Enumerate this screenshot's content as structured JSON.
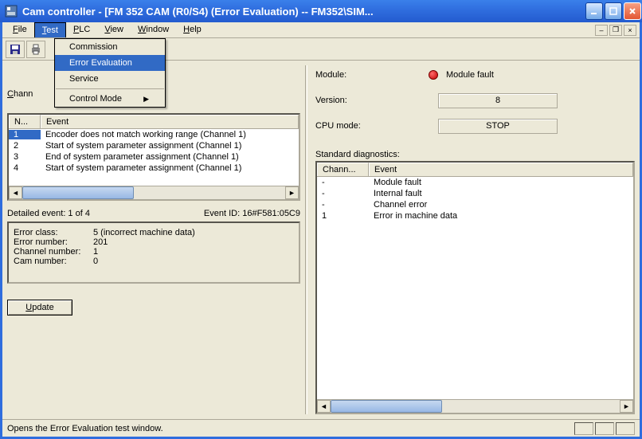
{
  "window": {
    "title": "Cam controller - [FM 352 CAM (R0/S4)  (Error Evaluation) -- FM352\\SIM..."
  },
  "menubar": [
    "File",
    "Test",
    "PLC",
    "View",
    "Window",
    "Help"
  ],
  "test_menu": {
    "items": [
      "Commission",
      "Error Evaluation",
      "Service",
      "Control Mode"
    ],
    "selected_index": 1,
    "submenu_index": 3
  },
  "left": {
    "channel_label_visible": "Chann",
    "table": {
      "headers": {
        "n": "N...",
        "event": "Event"
      },
      "rows": [
        {
          "n": "1",
          "event": "Encoder does not match working range (Channel   1)",
          "selected": true
        },
        {
          "n": "2",
          "event": "Start of system parameter assignment (Channel   1)",
          "selected": false
        },
        {
          "n": "3",
          "event": "End of system parameter assignment (Channel   1)",
          "selected": false
        },
        {
          "n": "4",
          "event": "Start of system parameter assignment (Channel   1)",
          "selected": false
        }
      ]
    },
    "detail_label": "Detailed event: 1 of 4",
    "event_id_label": "Event ID: 16#F581:05C9",
    "details": [
      {
        "k": "Error class:",
        "v": "5 (incorrect machine data)"
      },
      {
        "k": "Error number:",
        "v": "201"
      },
      {
        "k": "Channel number:",
        "v": "1"
      },
      {
        "k": "Cam number:",
        "v": "0"
      }
    ],
    "update_btn": "Update"
  },
  "right": {
    "module_label": "Module:",
    "module_status": "Module fault",
    "version_label": "Version:",
    "version_value": "8",
    "cpu_label": "CPU mode:",
    "cpu_value": "STOP",
    "sd_label": "Standard diagnostics:",
    "sd_headers": {
      "ch": "Chann...",
      "event": "Event"
    },
    "sd_rows": [
      {
        "ch": "-",
        "event": "Module fault"
      },
      {
        "ch": "-",
        "event": "Internal fault"
      },
      {
        "ch": "-",
        "event": "Channel error"
      },
      {
        "ch": "1",
        "event": "Error in machine data"
      }
    ]
  },
  "statusbar": {
    "msg": "Opens the Error Evaluation test window."
  }
}
